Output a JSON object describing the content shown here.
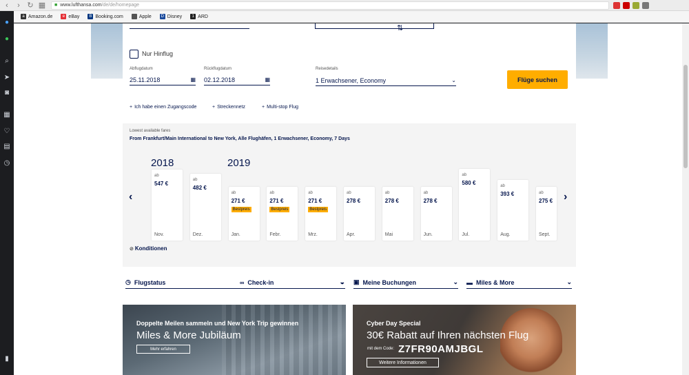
{
  "browser": {
    "url_host": "www.lufthansa.com",
    "url_path": "/de/de/homepage",
    "bookmarks": [
      {
        "label": "Amazon.de",
        "icon": "amazon-icon",
        "color": "#333333"
      },
      {
        "label": "eBay",
        "icon": "ebay-icon",
        "color": "#e53238"
      },
      {
        "label": "Booking.com",
        "icon": "booking-icon",
        "color": "#003580"
      },
      {
        "label": "Apple",
        "icon": "apple-icon",
        "color": "#555555"
      },
      {
        "label": "Disney",
        "icon": "disney-icon",
        "color": "#1a4a9c"
      },
      {
        "label": "ARD",
        "icon": "ard-icon",
        "color": "#222222"
      }
    ]
  },
  "booking": {
    "one_way_label": "Nur Hinflug",
    "depart_label": "Abflugdatum",
    "depart_value": "25.11.2018",
    "return_label": "Rückflugdatum",
    "return_value": "02.12.2018",
    "travel_label": "Reisedetails",
    "travel_value": "1 Erwachsener, Economy",
    "search_button": "Flüge suchen",
    "links": [
      "Ich habe einen Zugangscode",
      "Streckennetz",
      "Multi-stop Flug"
    ]
  },
  "fares": {
    "small_title": "Lowest available fares",
    "title": "From Frankfurt/Main International to New York, Alle Flughäfen, 1 Erwachsener, Economy, 7 Days",
    "years": [
      "2018",
      "2019"
    ],
    "ab_label": "ab",
    "best_label": "Bestpreis",
    "months": [
      {
        "month": "Nov.",
        "price": "547 €",
        "best": false
      },
      {
        "month": "Dez.",
        "price": "482 €",
        "best": false
      },
      {
        "month": "Jan.",
        "price": "271 €",
        "best": true
      },
      {
        "month": "Febr.",
        "price": "271 €",
        "best": true
      },
      {
        "month": "Mrz.",
        "price": "271 €",
        "best": true
      },
      {
        "month": "Apr.",
        "price": "278 €",
        "best": false
      },
      {
        "month": "Mai",
        "price": "278 €",
        "best": false
      },
      {
        "month": "Jun.",
        "price": "278 €",
        "best": false
      },
      {
        "month": "Jul.",
        "price": "580 €",
        "best": false
      },
      {
        "month": "Aug.",
        "price": "393 €",
        "best": false
      },
      {
        "month": "Sept.",
        "price": "275 €",
        "best": false
      }
    ],
    "conditions": "Konditionen"
  },
  "quick_menu": [
    {
      "label": "Flugstatus",
      "icon": "clock-icon"
    },
    {
      "label": "Check-in",
      "icon": "binoculars-icon"
    },
    {
      "label": "Meine Buchungen",
      "icon": "bookings-icon"
    },
    {
      "label": "Miles & More",
      "icon": "miles-icon"
    }
  ],
  "promos": {
    "left_sub": "Doppelte Meilen sammeln und New York Trip gewinnen",
    "left_big": "Miles & More Jubiläum",
    "left_button": "Mehr erfahren",
    "right_sub": "Cyber Day Special",
    "right_big": "30€ Rabatt auf Ihren nächsten Flug",
    "right_code_label": "mit dem Code:",
    "right_code": "Z7FR90AMJBGL",
    "right_button": "Weitere Informationen"
  },
  "colors": {
    "brand_navy": "#05164d",
    "brand_yellow": "#ffad00"
  }
}
